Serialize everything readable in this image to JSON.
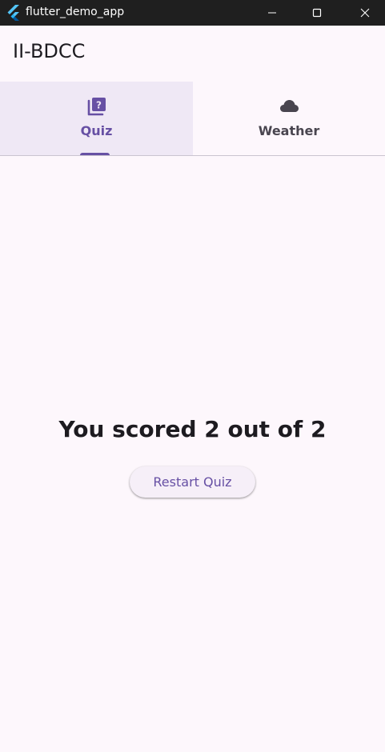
{
  "window": {
    "title": "flutter_demo_app",
    "logo_icon": "flutter-logo-icon",
    "controls": [
      "minimize-icon",
      "maximize-icon",
      "close-icon"
    ]
  },
  "appbar": {
    "title": "II-BDCC"
  },
  "tabs": [
    {
      "label": "Quiz",
      "icon": "quiz-icon",
      "selected": true
    },
    {
      "label": "Weather",
      "icon": "cloud-icon",
      "selected": false
    }
  ],
  "quiz": {
    "result_text": "You scored 2 out of 2",
    "restart_label": "Restart Quiz"
  },
  "colors": {
    "primary": "#6750a4",
    "background": "#fdf7fc",
    "selected_tab_bg": "#efe8f5",
    "titlebar": "#1f1f1f"
  }
}
